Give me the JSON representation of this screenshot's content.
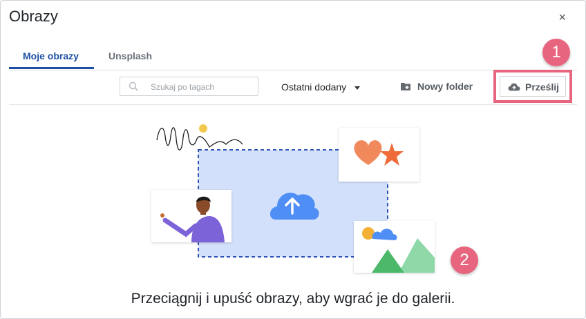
{
  "dialog": {
    "title": "Obrazy",
    "close_label": "×"
  },
  "tabs": [
    {
      "label": "Moje obrazy",
      "active": true
    },
    {
      "label": "Unsplash",
      "active": false
    }
  ],
  "toolbar": {
    "search_placeholder": "Szukaj po tagach",
    "sort_label": "Ostatni dodany",
    "new_folder_label": "Nowy folder",
    "upload_label": "Prześlij"
  },
  "badges": {
    "first": "1",
    "second": "2"
  },
  "dropzone": {
    "caption": "Przeciągnij i upuść obrazy, aby wgrać je do galerii."
  },
  "colors": {
    "accent": "#1e4fa3",
    "highlight": "#e8657f",
    "dropzone_fill": "#d3e0fb",
    "dropzone_border": "#2f54b7",
    "cloud": "#4f8ef5"
  },
  "icons": [
    "close-icon",
    "search-icon",
    "caret-down-icon",
    "folder-plus-icon",
    "cloud-upload-icon"
  ]
}
